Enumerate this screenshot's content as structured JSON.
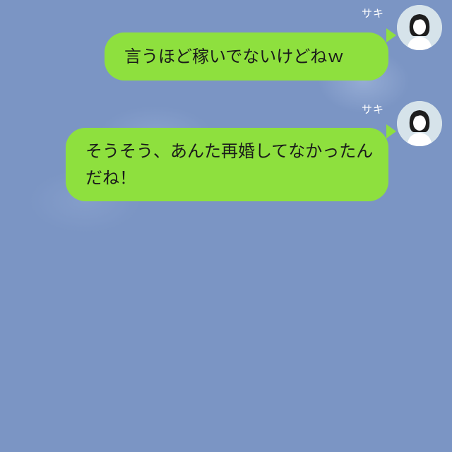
{
  "messages": [
    {
      "sender": "サキ",
      "text": "言うほど稼いでないけどねｗ"
    },
    {
      "sender": "サキ",
      "text": "そうそう、あんた再婚してなかったんだね！"
    }
  ],
  "colors": {
    "background": "#7b95c4",
    "bubble": "#8ee03e",
    "bubble_text": "#1a1a1a",
    "name_text": "#ffffff"
  },
  "icons": {
    "avatar": "woman-portrait-icon"
  }
}
